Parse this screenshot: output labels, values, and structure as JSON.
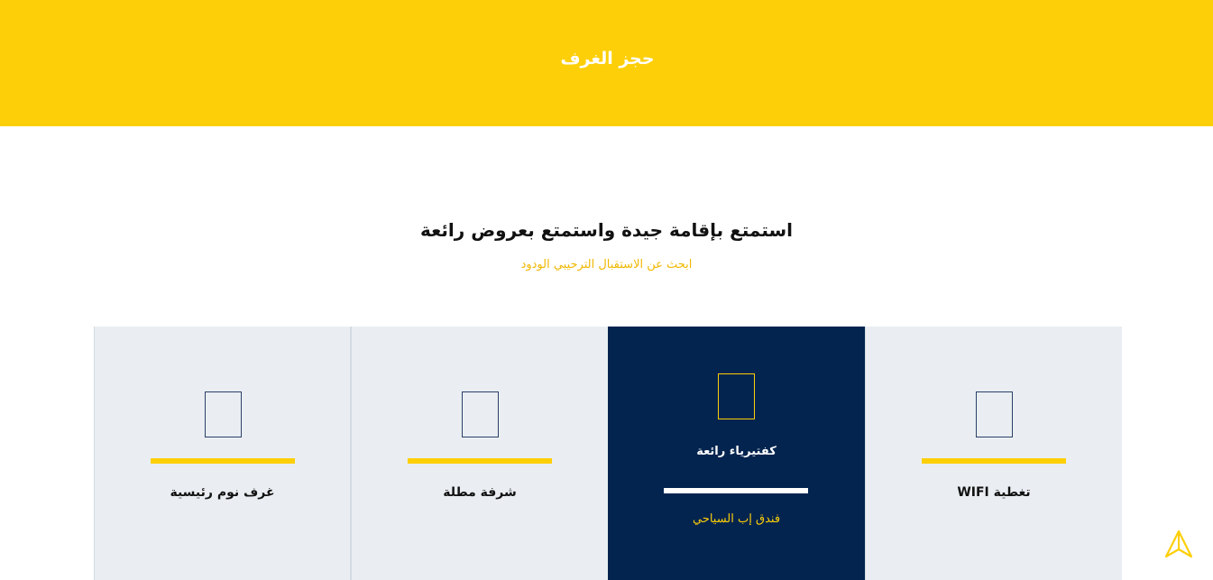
{
  "header": {
    "title": "حجز الغرف"
  },
  "intro": {
    "heading": "استمتع بإقامة جيدة واستمتع بعروض رائعة",
    "subheading": "ابحث عن الاستقبال الترحيبي الودود"
  },
  "features": [
    {
      "title": "تغطية WIFI",
      "icon": "room-feature-icon"
    },
    {
      "title": "كفتيرياء رائعة",
      "subtitle": "فندق إب السياحي",
      "icon": "cafeteria-icon",
      "active": true
    },
    {
      "title": "شرفة مطلة",
      "icon": "balcony-icon"
    },
    {
      "title": "غرف نوم رئيسية",
      "icon": "bedroom-icon"
    }
  ],
  "colors": {
    "accent": "#fdcf08",
    "navy": "#03244f",
    "card_bg": "#eaeef2"
  },
  "scroll_top": {
    "icon": "navigation-arrow-icon"
  }
}
